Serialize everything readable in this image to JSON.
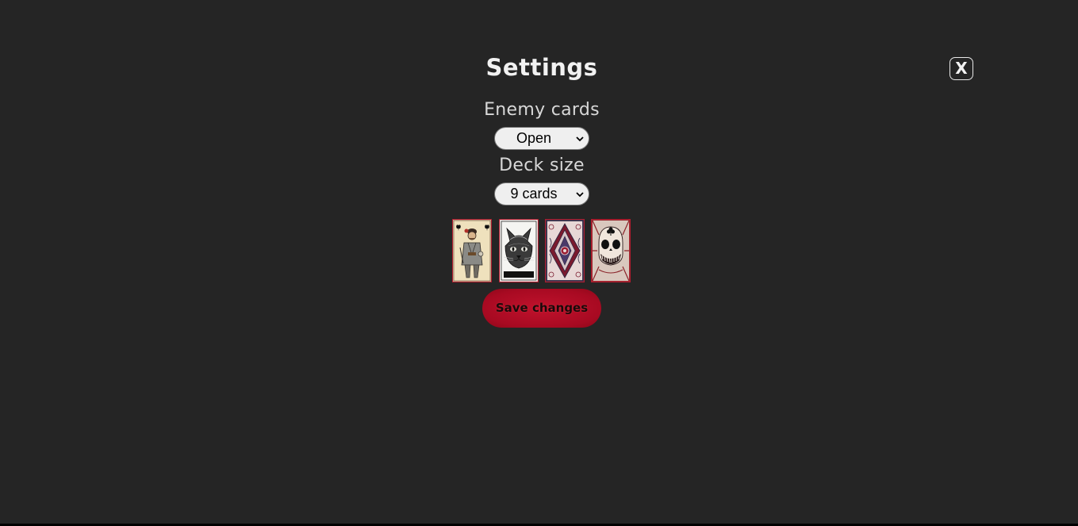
{
  "settings": {
    "title": "Settings",
    "close_label": "X",
    "enemy_cards": {
      "label": "Enemy cards",
      "selected": "Open"
    },
    "deck_size": {
      "label": "Deck size",
      "selected": "9 cards"
    },
    "card_backs": [
      {
        "name": "knight-of-spades"
      },
      {
        "name": "cat"
      },
      {
        "name": "ornamental-pattern"
      },
      {
        "name": "skull-of-clubs"
      }
    ],
    "save_label": "Save changes"
  },
  "colors": {
    "background": "#252525",
    "accent": "#b00e26",
    "card_border": "#b01c2e"
  }
}
